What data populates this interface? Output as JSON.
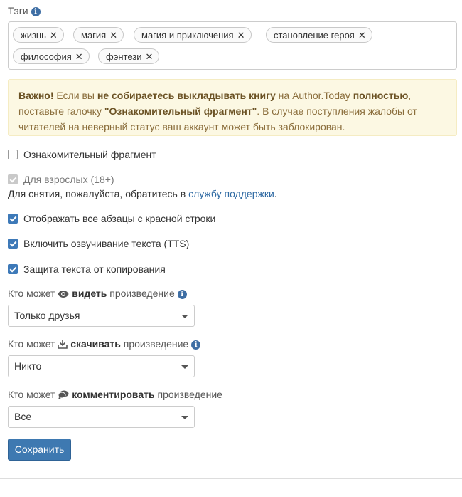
{
  "tags": {
    "label": "Тэги",
    "items": [
      "жизнь",
      "магия",
      "магия и приключения",
      "становление героя",
      "философия",
      "фэнтези"
    ],
    "remove_glyph": "✕"
  },
  "notice": {
    "strong1": "Важно!",
    "t1": " Если вы ",
    "strong2": "не собираетесь выкладывать книгу",
    "t2": " на Author.Today ",
    "strong3": "полностью",
    "t3": ", поставьте галочку ",
    "strong4": "\"Ознакомительный фрагмент\"",
    "t4": ". В случае поступления жалобы от читателей на неверный статус ваш аккаунт может быть заблокирован."
  },
  "options": {
    "fragment": {
      "label": "Ознакомительный фрагмент",
      "checked": false
    },
    "adult": {
      "label": "Для взрослых (18+)",
      "checked": true,
      "disabled": true,
      "hint": "Для снятия, пожалуйста, обратитесь в ",
      "hint_link": "службу поддержки",
      "hint_end": "."
    },
    "red_line": {
      "label": "Отображать все абзацы с красной строки",
      "checked": true
    },
    "tts": {
      "label": "Включить озвучивание текста (TTS)",
      "checked": true
    },
    "copy_protect": {
      "label": "Защита текста от копирования",
      "checked": true
    }
  },
  "permissions": {
    "view": {
      "prefix": "Кто может ",
      "verb": "видеть",
      "suffix": " произведение",
      "value": "Только друзья",
      "icon": "eye-icon"
    },
    "download": {
      "prefix": "Кто может ",
      "verb": "скачивать",
      "suffix": " произведение",
      "value": "Никто",
      "icon": "download-icon"
    },
    "comment": {
      "prefix": "Кто может ",
      "verb": "комментировать",
      "suffix": " произведение",
      "value": "Все",
      "icon": "comment-icon"
    }
  },
  "save_label": "Сохранить",
  "colors": {
    "accent": "#3e79b1",
    "notice_bg": "#fcf8e3",
    "notice_text": "#8a6d3b"
  }
}
